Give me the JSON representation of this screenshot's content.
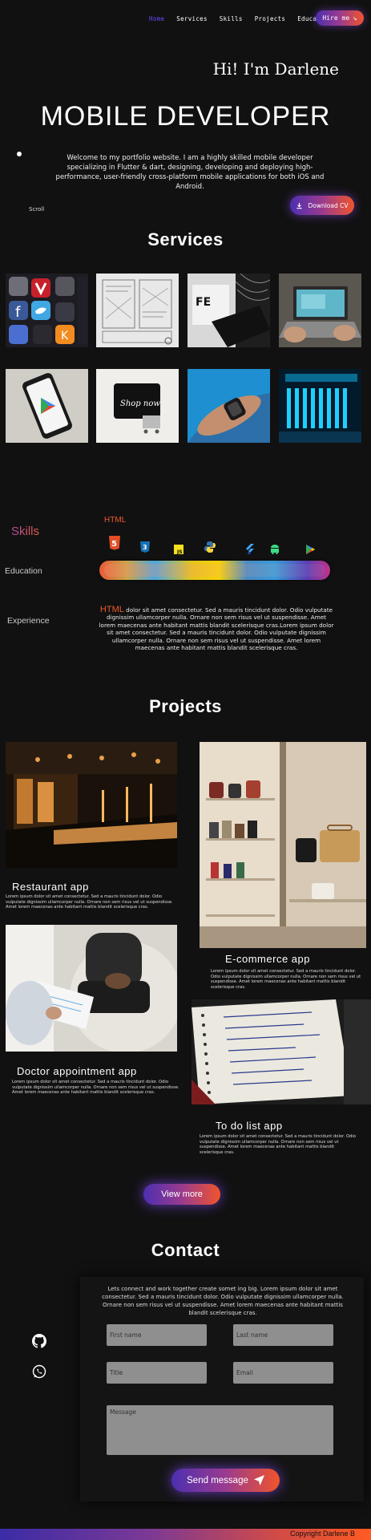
{
  "nav": {
    "items": [
      "Home",
      "Services",
      "Skills",
      "Projects",
      "Education"
    ],
    "hire_label": "Hire me",
    "hire_arrow": "↘"
  },
  "hero": {
    "greeting": "Hi! I'm Darlene",
    "headline": "MOBILE DEVELOPER",
    "intro": "Welcome to my portfolio website. I am a highly skilled mobile developer specializing in Flutter & dart, designing, developing and deploying high-performance, user-friendly cross-platform mobile applications for both iOS and Android.",
    "scroll": "Scroll",
    "cv_label": "Download CV"
  },
  "services": {
    "title": "Services"
  },
  "skills": {
    "tabs": [
      "Skills",
      "Education",
      "Experience"
    ],
    "active_label": "HTML",
    "languages": [
      "html5-icon",
      "css3-icon",
      "javascript-icon",
      "python-icon",
      "flutter-icon",
      "android-icon",
      "play-store-icon"
    ],
    "description_highlight": "HTML",
    "description": " dolor sit amet consectetur. Sed a mauris tincidunt dolor. Odio vulputate dignissim ullamcorper nulla. Ornare non sem risus vel ut suspendisse. Amet lorem maecenas ante habitant mattis blandit scelerisque cras.Lorem ipsum dolor sit amet consectetur. Sed a mauris tincidunt dolor. Odio vulputate dignissim ullamcorper nulla. Ornare non sem risus vel ut suspendisse. Amet lorem maecenas ante habitant mattis blandit scelerisque cras."
  },
  "projects": {
    "title": "Projects",
    "items": [
      {
        "name": "Restaurant app",
        "desc": "Lorem ipsum dolor sit amet consectetur. Sed a mauris tincidunt dolor. Odio vulputate dignissim ullamcorper nulla. Ornare non sem risus vel ut suspendisse. Amet lorem maecenas ante habitant mattis blandit scelerisque cras."
      },
      {
        "name": "E-commerce app",
        "desc": "Lorem ipsum dolor sit amet consectetur. Sed a mauris tincidunt dolor. Odio vulputate dignissim ullamcorper nulla. Ornare non sem risus vel ut suspendisse. Amet lorem maecenas ante habitant mattis blandit scelerisque cras."
      },
      {
        "name": "Doctor appointment app",
        "desc": "Lorem ipsum dolor sit amet consectetur. Sed a mauris tincidunt dolor. Odio vulputate dignissim ullamcorper nulla. Ornare non sem risus vel ut suspendisse. Amet lorem maecenas ante habitant mattis blandit scelerisque cras."
      },
      {
        "name": "To do list app",
        "desc": "Lorem ipsum dolor sit amet consectetur. Sed a mauris tincidunt dolor. Odio vulputate dignissim ullamcorper nulla. Ornare non sem risus vel ut suspendisse. Amet lorem maecenas ante habitant mattis blandit scelerisque cras."
      }
    ],
    "view_more": "View more"
  },
  "contact": {
    "title": "Contact",
    "text": "Lets connect and work together create somet ing big. Lorem ipsum dolor sit amet consectetur. Sed a mauris tincidunt dolor. Odio vulputate dignissim ullamcorper nulla. Ornare non sem risus vel ut suspendisse. Amet lorem maecenas ante habitant mattis blandit scelerisque cras.",
    "first_name": "First name",
    "last_name": "Last name",
    "title_field": "Title",
    "email": "Email",
    "message": "Message",
    "send_label": "Send message"
  },
  "footer": {
    "copyright": "Copyright Darlene B"
  },
  "colors": {
    "background": "#111111",
    "accent_purple": "#4c2fb0",
    "accent_orange": "#f0542b",
    "nav_active": "#6a4cff"
  }
}
